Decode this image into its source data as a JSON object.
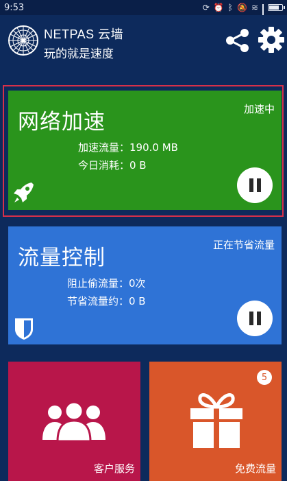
{
  "status_bar": {
    "time": "9:53"
  },
  "header": {
    "title": "NETPAS 云墙",
    "slogan": "玩的就是速度"
  },
  "accelerate": {
    "title": "网络加速",
    "status": "加速中",
    "traffic_label": "加速流量：190.0 MB",
    "today_label": "今日消耗：0 B"
  },
  "traffic_control": {
    "title": "流量控制",
    "status": "正在节省流量",
    "blocked_label": "阻止偷流量：0次",
    "saved_label": "节省流量约：0 B"
  },
  "tiles": {
    "service_label": "客户服务",
    "free_label": "免费流量",
    "free_badge": "5"
  },
  "colors": {
    "background": "#0d2a5c",
    "accelerate": "#2a941c",
    "traffic_control": "#2f73d6",
    "service": "#b8164a",
    "free": "#d9562a",
    "highlight": "#d6304a"
  }
}
